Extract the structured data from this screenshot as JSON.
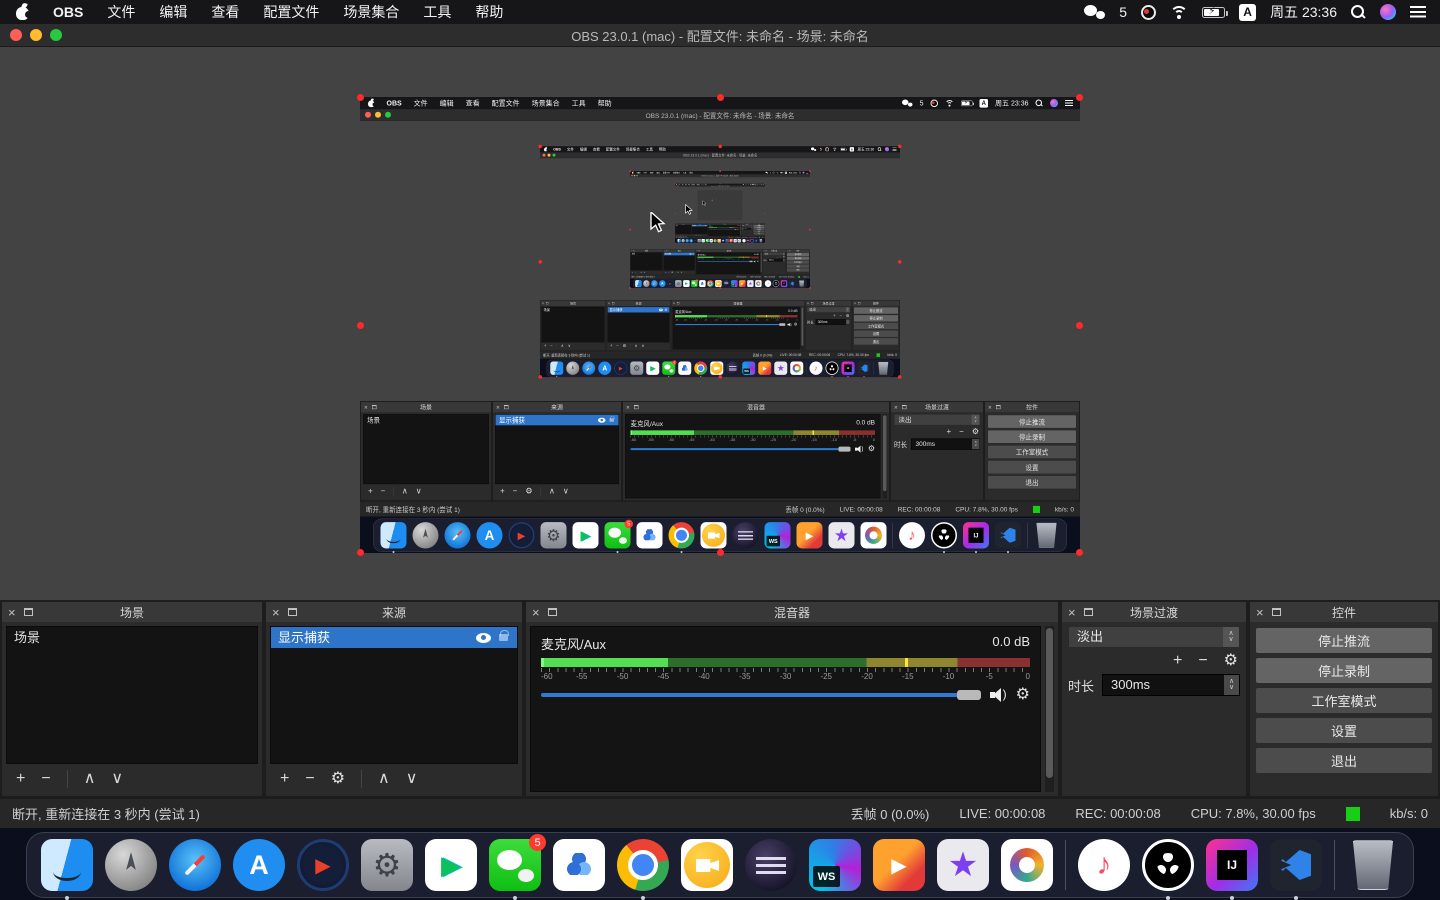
{
  "menubar": {
    "menus": [
      "OBS",
      "文件",
      "编辑",
      "查看",
      "配置文件",
      "场景集合",
      "工具",
      "帮助"
    ],
    "status": {
      "wechat_count": "5",
      "input_letter": "A",
      "clock": "周五 23:36"
    }
  },
  "window": {
    "title": "OBS 23.0.1 (mac) - 配置文件: 未命名 - 场景: 未命名"
  },
  "panels": {
    "scenes": {
      "title": "场景",
      "items": [
        "场景"
      ]
    },
    "sources": {
      "title": "来源",
      "selected_item": "显示捕获"
    },
    "mixer": {
      "title": "混音器",
      "channel": "麦克风/Aux",
      "level_db": "0.0 dB",
      "ticks": [
        "-60",
        "-55",
        "-50",
        "-45",
        "-40",
        "-35",
        "-30",
        "-25",
        "-20",
        "-15",
        "-10",
        "-5",
        "0"
      ]
    },
    "transitions": {
      "title": "场景过渡",
      "selected": "淡出",
      "duration_label": "时长",
      "duration_value": "300ms"
    },
    "controls": {
      "title": "控件",
      "buttons": [
        "停止推流",
        "停止录制",
        "工作室模式",
        "设置",
        "退出"
      ]
    }
  },
  "statusbar": {
    "message": "断开, 重新连接在 3 秒内 (尝试 1)",
    "dropped_frames": "丢帧 0 (0.0%)",
    "live": "LIVE: 00:00:08",
    "rec": "REC: 00:00:08",
    "cpu": "CPU: 7.8%, 30.00 fps",
    "bitrate": "kb/s: 0"
  },
  "dock": {
    "wechat_badge": "5",
    "apps": [
      "finder",
      "launchpad",
      "safari",
      "app-store",
      "video-player-red",
      "system-preferences",
      "tencent-video",
      "wechat",
      "baidu-netdisk",
      "chrome",
      "screen-recorder-yellow",
      "eclipse",
      "webstorm",
      "media-app-orange",
      "imovie",
      "navicat",
      "music",
      "obs",
      "intellij-idea",
      "vscode",
      "trash"
    ],
    "running_apps": [
      "finder",
      "wechat",
      "chrome",
      "obs",
      "intellij-idea",
      "vscode"
    ]
  },
  "colors": {
    "selection_red": "#ff2a2a",
    "source_selected_blue": "#2e74c9",
    "slider_blue": "#2e7bd6",
    "status_green": "#16cf16",
    "meter_bright_green": "#52e052",
    "meter_dim_green": "#2c6e2c",
    "meter_dim_yellow": "#8f8630",
    "meter_dim_red": "#8a3030",
    "meter_peak_yellow": "#ffe53a"
  }
}
